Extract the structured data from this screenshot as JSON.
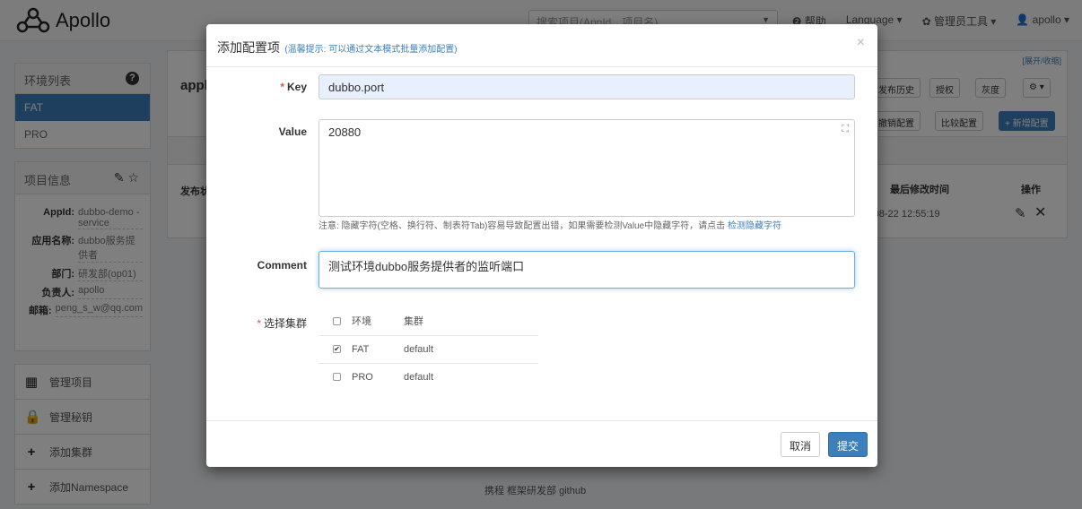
{
  "navbar": {
    "logo_text": "Apollo",
    "search_placeholder": "搜索项目(AppId、项目名)",
    "links": [
      "❷ 帮助",
      "Language ▾",
      "✿ 管理员工具 ▾",
      "👤 apollo ▾"
    ]
  },
  "sidebar": {
    "env_title": "环境列表",
    "envs": [
      "FAT",
      "PRO"
    ],
    "info_title": "项目信息",
    "info": [
      {
        "k": "AppId:",
        "v": "dubbo-demo -service"
      },
      {
        "k": "应用名称:",
        "v": "dubbo服务提供者"
      },
      {
        "k": "部门:",
        "v": "研发部(op01)"
      },
      {
        "k": "负责人:",
        "v": "apollo"
      },
      {
        "k": "邮箱:",
        "v": "peng_s_w@qq.com"
      }
    ],
    "menu": [
      "管理项目",
      "管理秘钥",
      "添加集群",
      "添加Namespace"
    ]
  },
  "main": {
    "toggle": "[展开/收缩]",
    "app_prefix": "appl",
    "buttons": [
      "发布历史",
      "授权",
      "灰度",
      "⚙ ▾",
      "撤销配置",
      "比较配置",
      "+ 新增配置"
    ],
    "col_publish": "发布状",
    "col_modified": "最后修改时间",
    "col_ops": "操作",
    "row_time": "-08-22 12:55:19",
    "footer": "携程 框架研发部  github"
  },
  "modal": {
    "title": "添加配置项",
    "tip": "(温馨提示: 可以通过文本模式批量添加配置)",
    "close": "×",
    "key_label": "Key",
    "key_value": "dubbo.port",
    "value_label": "Value",
    "value_value": "20880",
    "note": "注意: 隐藏字符(空格、换行符、制表符Tab)容易导致配置出错，如果需要检测Value中隐藏字符，请点击",
    "note_link": "检测隐藏字符",
    "comment_label": "Comment",
    "comment_value": "测试环境dubbo服务提供者的监听端口",
    "cluster_label": "选择集群",
    "cluster_head": {
      "env": "环境",
      "cluster": "集群"
    },
    "clusters": [
      {
        "env": "FAT",
        "cluster": "default",
        "checked": true
      },
      {
        "env": "PRO",
        "cluster": "default",
        "checked": false
      }
    ],
    "cancel": "取消",
    "submit": "提交"
  }
}
